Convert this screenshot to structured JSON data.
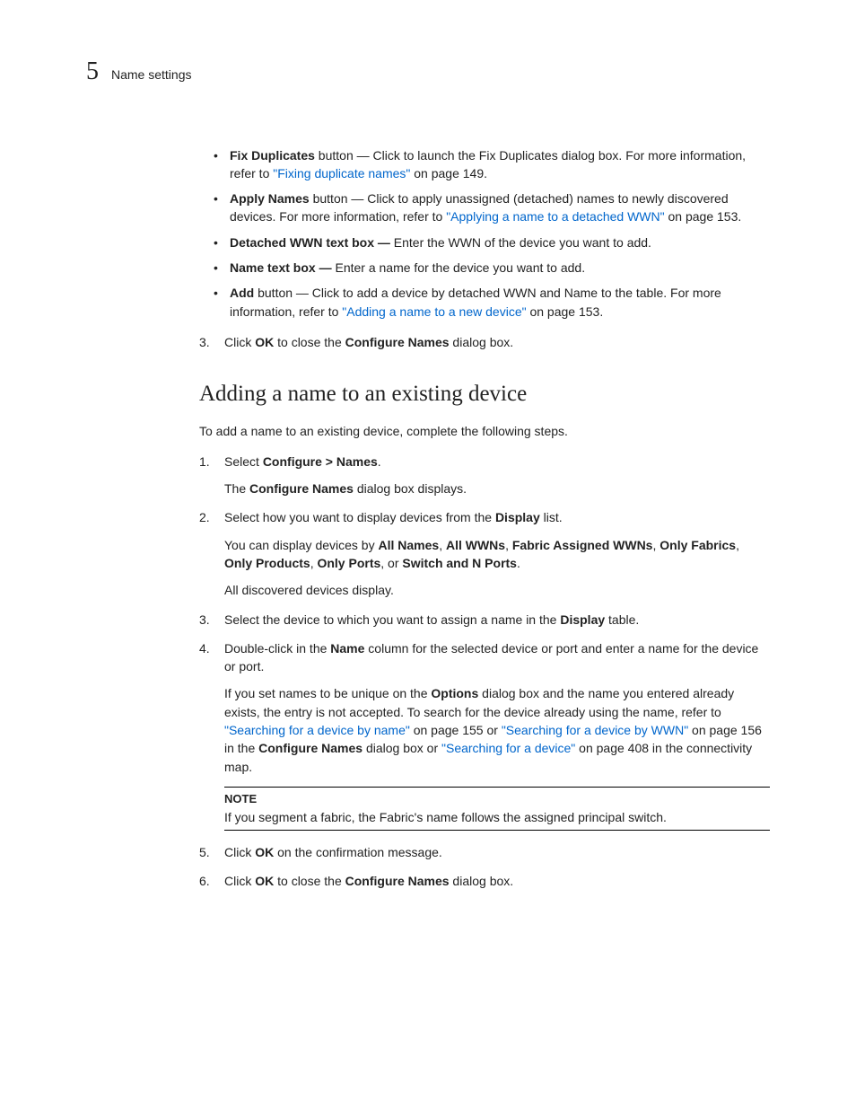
{
  "header": {
    "chapter_number": "5",
    "chapter_title": "Name settings"
  },
  "bullets": [
    {
      "bold": "Fix Duplicates",
      "after_bold": " button — Click to launch the Fix Duplicates dialog box. For more information, refer to ",
      "link": "\"Fixing duplicate names\"",
      "after_link": " on page 149."
    },
    {
      "bold": "Apply Names",
      "after_bold": " button — Click to apply unassigned (detached) names to newly discovered devices. For more information, refer to ",
      "link": "\"Applying a name to a detached WWN\"",
      "after_link": " on page 153."
    },
    {
      "bold": "Detached WWN text box —",
      "after_bold": " Enter the WWN of the device you want to add.",
      "link": "",
      "after_link": ""
    },
    {
      "bold": "Name text box —",
      "after_bold": " Enter a name for the device you want to add.",
      "link": "",
      "after_link": ""
    },
    {
      "bold": "Add",
      "after_bold": " button — Click to add a device by detached WWN and Name to the table. For more information, refer to ",
      "link": "\"Adding a name to a new device\"",
      "after_link": " on page 153."
    }
  ],
  "step3_top": {
    "pre": "Click ",
    "b1": "OK",
    "mid": " to close the ",
    "b2": "Configure Names",
    "post": " dialog box."
  },
  "section_heading": "Adding a name to an existing device",
  "intro": "To add a name to an existing device, complete the following steps.",
  "steps": {
    "s1": {
      "pre": "Select ",
      "b1": "Configure > Names",
      "post": ".",
      "p1_pre": "The ",
      "p1_b": "Configure Names",
      "p1_post": " dialog box displays."
    },
    "s2": {
      "pre": "Select how you want to display devices from the ",
      "b1": "Display",
      "post": " list.",
      "p1_pre": "You can display devices by ",
      "p1_b1": "All Names",
      "p1_c1": ", ",
      "p1_b2": "All WWNs",
      "p1_c2": ", ",
      "p1_b3": "Fabric Assigned WWNs",
      "p1_c3": ", ",
      "p1_b4": "Only Fabrics",
      "p1_c4": ", ",
      "p1_b5": "Only Products",
      "p1_c5": ", ",
      "p1_b6": "Only Ports",
      "p1_c6": ", or ",
      "p1_b7": "Switch and N Ports",
      "p1_post": ".",
      "p2": "All discovered devices display."
    },
    "s3": {
      "pre": "Select the device to which you want to assign a name in the ",
      "b1": "Display",
      "post": " table."
    },
    "s4": {
      "pre": "Double-click in the ",
      "b1": "Name",
      "post": " column for the selected device or port and enter a name for the device or port.",
      "p1_pre": "If you set names to be unique on the ",
      "p1_b1": "Options",
      "p1_mid": " dialog box and the name you entered already exists, the entry is not accepted. To search for the device already using the name, refer to ",
      "p1_link1": "\"Searching for a device by name\"",
      "p1_a1": " on page 155 or ",
      "p1_link2": "\"Searching for a device by WWN\"",
      "p1_a2": " on page 156 in the ",
      "p1_b2": "Configure Names",
      "p1_a3": " dialog box or ",
      "p1_link3": "\"Searching for a device\"",
      "p1_a4": " on page 408 in the connectivity map."
    },
    "s5": {
      "pre": "Click ",
      "b1": "OK",
      "post": " on the confirmation message."
    },
    "s6": {
      "pre": "Click ",
      "b1": "OK",
      "mid": " to close the ",
      "b2": "Configure Names",
      "post": " dialog box."
    }
  },
  "note": {
    "label": "NOTE",
    "body": "If you segment a fabric, the Fabric's name follows the assigned principal switch."
  }
}
